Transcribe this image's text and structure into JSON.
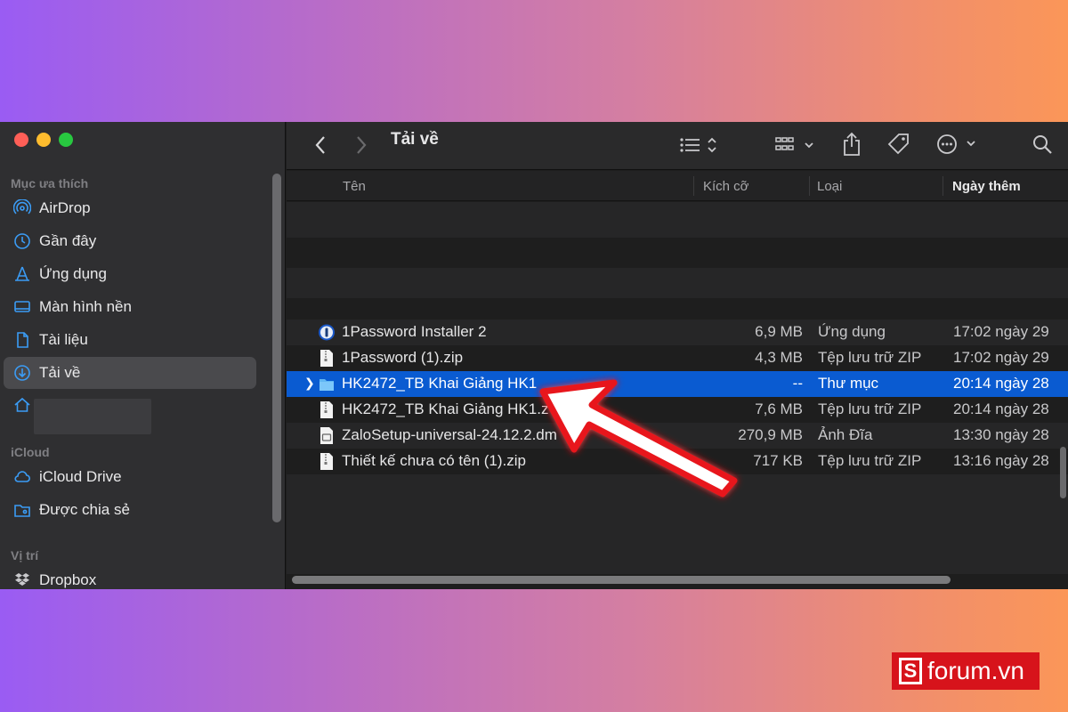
{
  "window": {
    "title": "Tải về"
  },
  "sidebar": {
    "favorites_title": "Mục ưa thích",
    "favorites": [
      {
        "label": "AirDrop",
        "icon": "airdrop-icon"
      },
      {
        "label": "Gần đây",
        "icon": "clock-icon"
      },
      {
        "label": "Ứng dụng",
        "icon": "applications-icon"
      },
      {
        "label": "Màn hình nền",
        "icon": "desktop-icon"
      },
      {
        "label": "Tài liệu",
        "icon": "document-icon"
      },
      {
        "label": "Tải về",
        "icon": "download-icon",
        "active": true
      },
      {
        "label": "",
        "icon": "home-icon"
      }
    ],
    "icloud_title": "iCloud",
    "icloud": [
      {
        "label": "iCloud Drive",
        "icon": "cloud-icon"
      },
      {
        "label": "Được chia sẻ",
        "icon": "shared-folder-icon"
      }
    ],
    "locations_title": "Vị trí",
    "locations": [
      {
        "label": "Dropbox",
        "icon": "dropbox-icon"
      }
    ]
  },
  "columns": {
    "name": "Tên",
    "size": "Kích cỡ",
    "kind": "Loại",
    "date_added": "Ngày thêm"
  },
  "files": [
    {
      "name": "1Password Installer 2",
      "size": "6,9 MB",
      "kind": "Ứng dụng",
      "date": "17:02 ngày 29",
      "icon": "app-icon"
    },
    {
      "name": "1Password (1).zip",
      "size": "4,3 MB",
      "kind": "Tệp lưu trữ ZIP",
      "date": "17:02 ngày 29",
      "icon": "zip-file-icon"
    },
    {
      "name": "HK2472_TB Khai Giảng HK1",
      "size": "--",
      "kind": "Thư mục",
      "date": "20:14 ngày 28",
      "icon": "folder-icon",
      "selected": true
    },
    {
      "name": "HK2472_TB Khai Giảng HK1.z",
      "size": "7,6 MB",
      "kind": "Tệp lưu trữ ZIP",
      "date": "20:14 ngày 28",
      "icon": "zip-file-icon"
    },
    {
      "name": "ZaloSetup-universal-24.12.2.dm",
      "size": "270,9 MB",
      "kind": "Ảnh Đĩa",
      "date": "13:30 ngày 28",
      "icon": "disk-image-icon"
    },
    {
      "name": "Thiết kế chưa có tên (1).zip",
      "size": "717 KB",
      "kind": "Tệp lưu trữ ZIP",
      "date": "13:16 ngày 28",
      "icon": "zip-file-icon"
    }
  ],
  "watermark": {
    "letter": "S",
    "text": "forum.vn"
  },
  "colors": {
    "selection": "#0a5bd1",
    "arrow": "#e8141b"
  }
}
